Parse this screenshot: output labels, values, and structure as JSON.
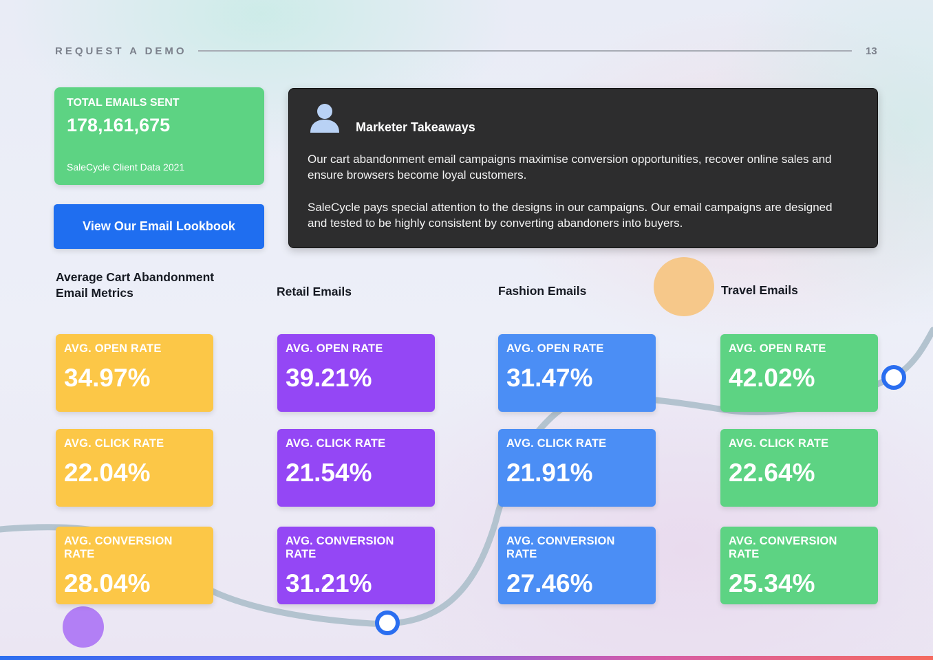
{
  "header": {
    "label": "REQUEST A DEMO",
    "page_number": "13"
  },
  "total_card": {
    "label": "TOTAL EMAILS SENT",
    "value": "178,161,675",
    "source": "SaleCycle Client Data 2021"
  },
  "lookbook_button": {
    "label": "View Our Email Lookbook"
  },
  "takeaways": {
    "title": "Marketer Takeaways",
    "paragraph1": "Our cart abandonment email campaigns maximise conversion opportunities, recover online sales and ensure browsers become loyal customers.",
    "paragraph2": "SaleCycle pays special attention to the designs in our campaigns. Our email campaigns are designed and tested to be highly consistent by converting abandoners into buyers."
  },
  "columns": [
    {
      "heading": "Average Cart Abandonment Email Metrics",
      "color": "#fcc747",
      "metrics": [
        {
          "label": "AVG. OPEN RATE",
          "value": "34.97%"
        },
        {
          "label": "AVG. CLICK RATE",
          "value": "22.04%"
        },
        {
          "label": "AVG. CONVERSION RATE",
          "value": "28.04%"
        }
      ]
    },
    {
      "heading": "Retail Emails",
      "color": "#9447f5",
      "metrics": [
        {
          "label": "AVG. OPEN RATE",
          "value": "39.21%"
        },
        {
          "label": "AVG. CLICK RATE",
          "value": "21.54%"
        },
        {
          "label": "AVG. CONVERSION RATE",
          "value": "31.21%"
        }
      ]
    },
    {
      "heading": "Fashion Emails",
      "color": "#4b8ef5",
      "metrics": [
        {
          "label": "AVG. OPEN RATE",
          "value": "31.47%"
        },
        {
          "label": "AVG. CLICK RATE",
          "value": "21.91%"
        },
        {
          "label": "AVG. CONVERSION RATE",
          "value": "27.46%"
        }
      ]
    },
    {
      "heading": "Travel Emails",
      "color": "#5dd383",
      "metrics": [
        {
          "label": "AVG. OPEN RATE",
          "value": "42.02%"
        },
        {
          "label": "AVG. CLICK RATE",
          "value": "22.64%"
        },
        {
          "label": "AVG. CONVERSION RATE",
          "value": "25.34%"
        }
      ]
    }
  ],
  "icons": {
    "takeaways": "person-icon"
  }
}
